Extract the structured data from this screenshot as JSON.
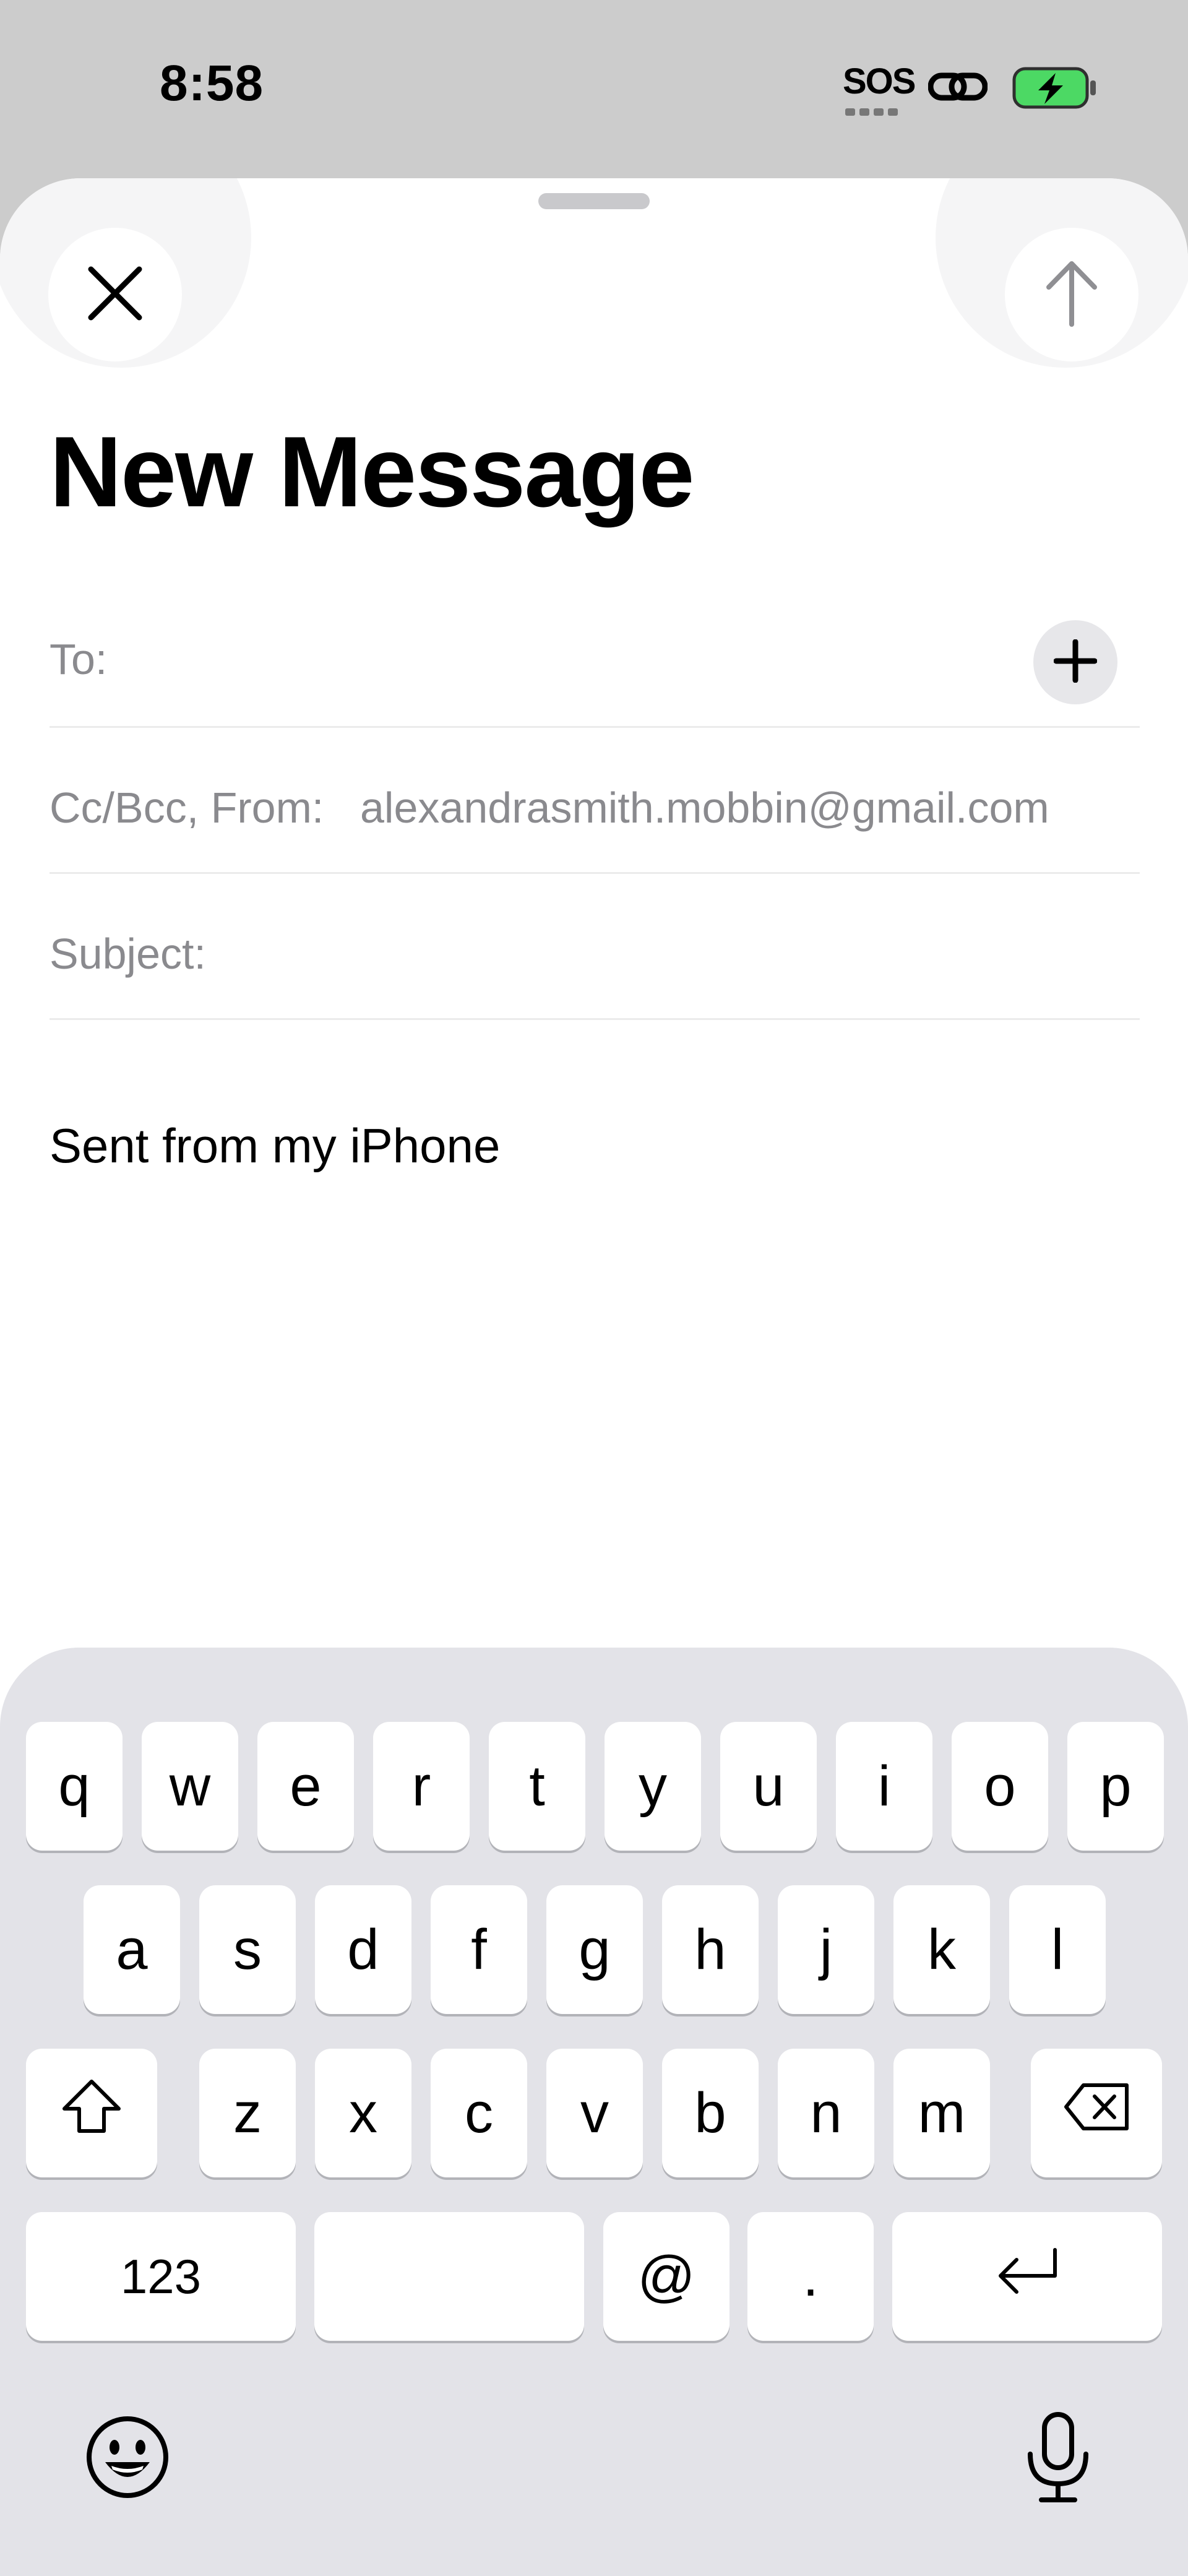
{
  "status_bar": {
    "time": "8:58",
    "sos": "SOS",
    "icons": [
      "link-icon",
      "battery-charging-icon"
    ],
    "battery_color": "#4cd964"
  },
  "compose": {
    "title": "New Message",
    "close_icon": "close-icon",
    "send_icon": "arrow-up-icon",
    "to_label": "To:",
    "add_contact_icon": "plus-icon",
    "cc_label": "Cc/Bcc, From:",
    "from_address": "alexandrasmith.mobbin@gmail.com",
    "subject_label": "Subject:",
    "signature": "Sent from my iPhone"
  },
  "keyboard": {
    "row1": [
      "q",
      "w",
      "e",
      "r",
      "t",
      "y",
      "u",
      "i",
      "o",
      "p"
    ],
    "row2": [
      "a",
      "s",
      "d",
      "f",
      "g",
      "h",
      "j",
      "k",
      "l"
    ],
    "row3": [
      "z",
      "x",
      "c",
      "v",
      "b",
      "n",
      "m"
    ],
    "numbers_label": "123",
    "space_label": "",
    "at_label": "@",
    "period_label": ".",
    "icons": [
      "shift-icon",
      "delete-icon",
      "return-icon",
      "emoji-icon",
      "microphone-icon"
    ]
  }
}
